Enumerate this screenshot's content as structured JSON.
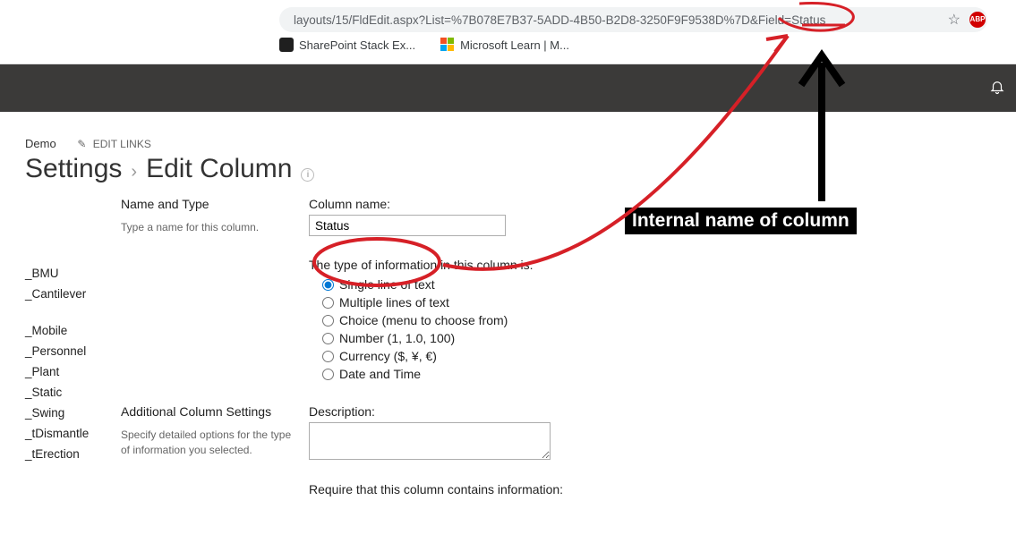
{
  "browser": {
    "url": "layouts/15/FldEdit.aspx?List=%7B078E7B37-5ADD-4B50-B2D8-3250F9F9538D%7D&Field=Status",
    "abp": "ABP",
    "bookmarks": [
      {
        "label": "SharePoint Stack Ex..."
      },
      {
        "label": "Microsoft Learn | M..."
      }
    ]
  },
  "topnav": {
    "site": "Demo",
    "editLinks": "EDIT LINKS"
  },
  "breadcrumb": {
    "settings": "Settings",
    "title": "Edit Column"
  },
  "leftnav": {
    "items": [
      "_BMU",
      "_Cantilever",
      "_Mobile",
      "_Personnel",
      "_Plant",
      "_Static",
      "_Swing",
      "_tDismantle",
      "_tErection"
    ]
  },
  "nameType": {
    "title": "Name and Type",
    "desc": "Type a name for this column.",
    "colNameLabel": "Column name:",
    "colNameValue": "Status",
    "typeIntro": "The type of information in this column is:",
    "types": [
      "Single line of text",
      "Multiple lines of text",
      "Choice (menu to choose from)",
      "Number (1, 1.0, 100)",
      "Currency ($, ¥, €)",
      "Date and Time"
    ]
  },
  "addlSettings": {
    "title": "Additional Column Settings",
    "desc": "Specify detailed options for the type of information you selected.",
    "descLabel": "Description:",
    "requireLabel": "Require that this column contains information:"
  },
  "annotation": {
    "text": "Internal name of column"
  }
}
